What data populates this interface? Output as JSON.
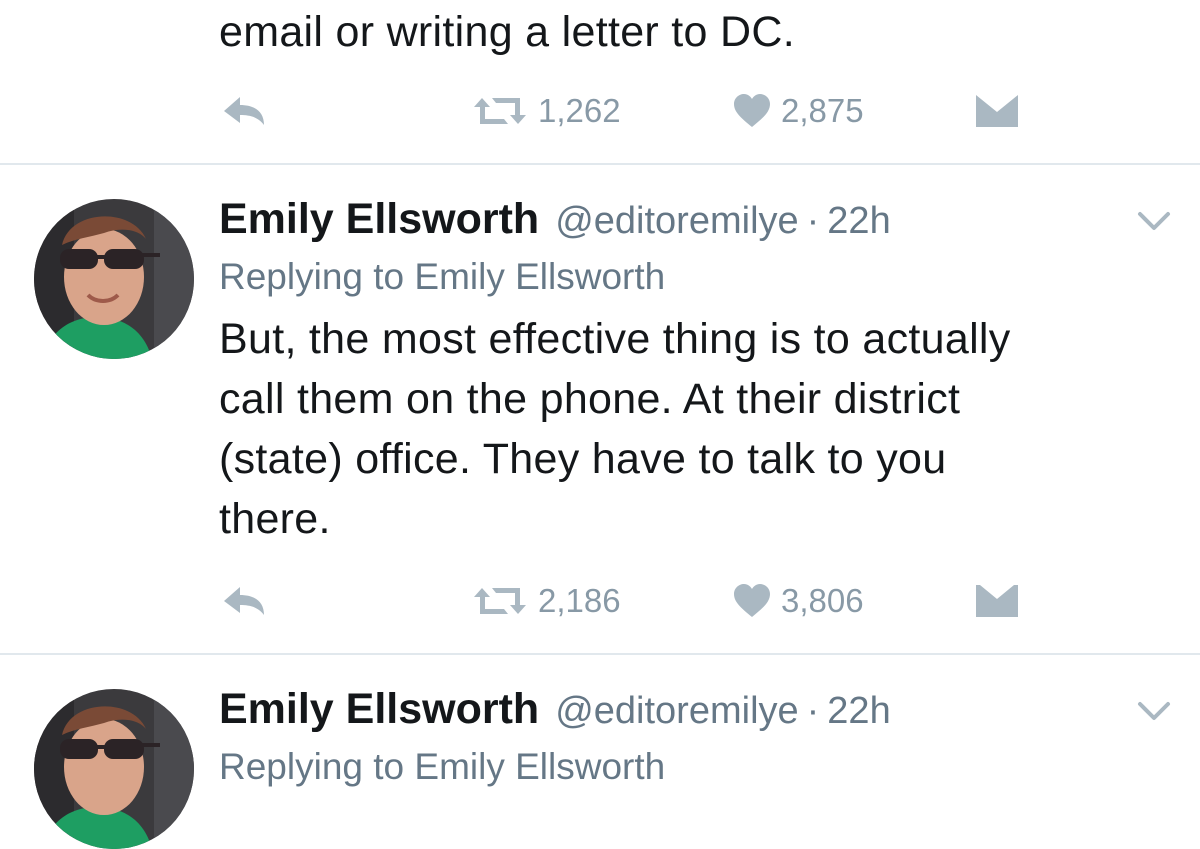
{
  "tweets": [
    {
      "text_lines": [
        "email or writing a letter to DC."
      ],
      "retweets": "1,262",
      "likes": "2,875",
      "icons": {
        "reply": "reply-icon",
        "retweet": "retweet-icon",
        "like": "heart-icon",
        "dm": "envelope-icon"
      }
    },
    {
      "author_name": "Emily Ellsworth",
      "author_handle": "@editoremilye",
      "separator": "·",
      "time": "22h",
      "replying_to": "Replying to Emily Ellsworth",
      "text_lines": [
        "But, the most effective thing is to actually",
        "call them on the phone. At their district",
        "(state) office. They have to talk to you",
        "there."
      ],
      "retweets": "2,186",
      "likes": "3,806",
      "icons": {
        "menu": "chevron-down-icon",
        "reply": "reply-icon",
        "retweet": "retweet-icon",
        "like": "heart-icon",
        "dm": "envelope-icon"
      }
    },
    {
      "author_name": "Emily Ellsworth",
      "author_handle": "@editoremilye",
      "separator": "·",
      "time": "22h",
      "replying_to": "Replying to Emily Ellsworth",
      "icons": {
        "menu": "chevron-down-icon"
      }
    }
  ],
  "colors": {
    "text": "#14171a",
    "secondary": "#657786",
    "icon": "#aab8c2",
    "divider": "#e1e8ed"
  }
}
